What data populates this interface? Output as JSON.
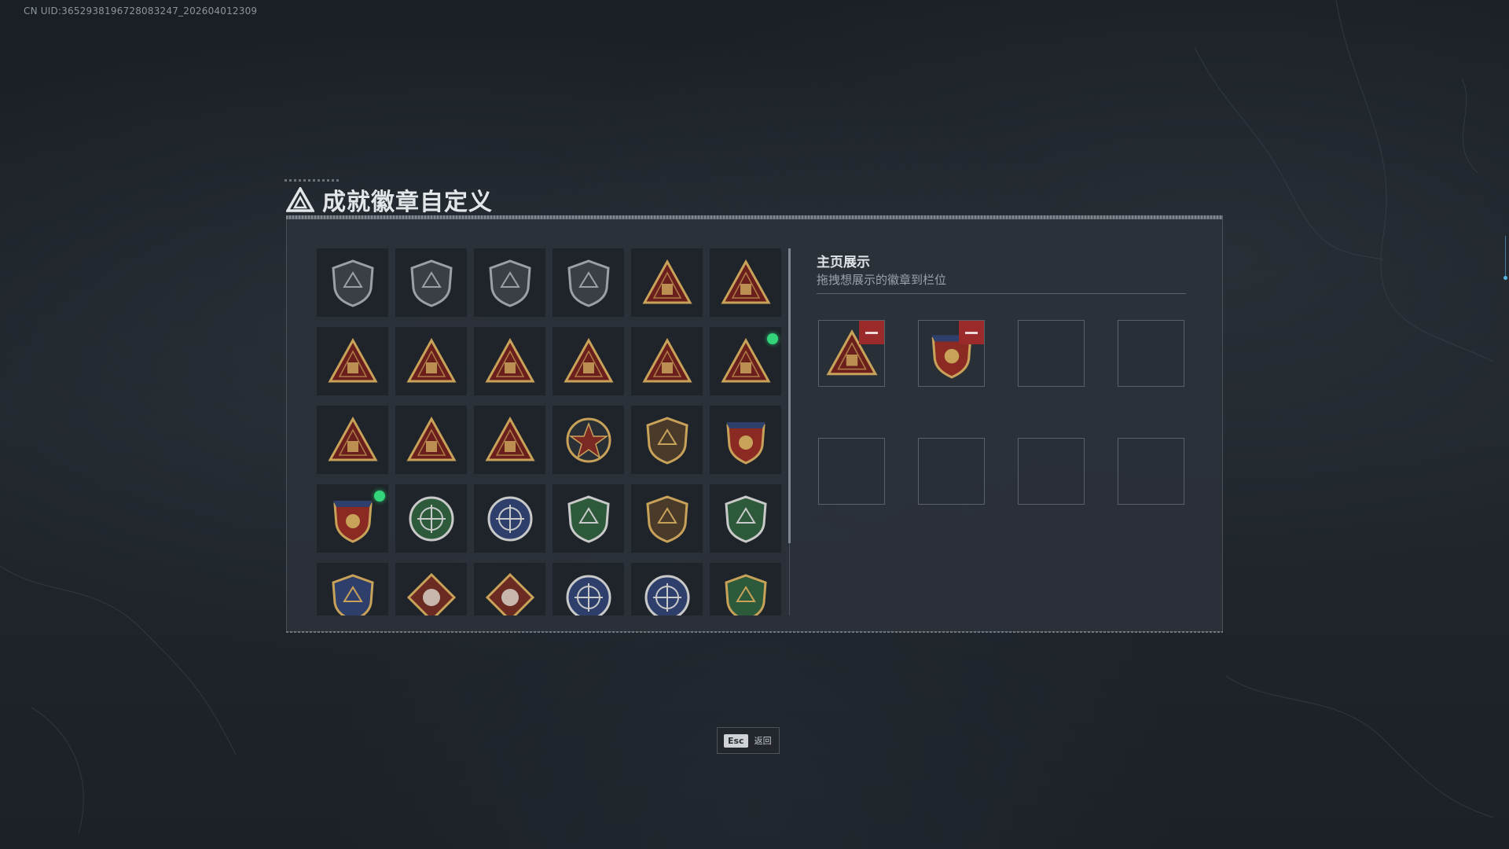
{
  "uid_text": "CN UID:3652938196728083247_202604012309",
  "page": {
    "title": "成就徽章自定义"
  },
  "badges": [
    {
      "shape": "shield",
      "color": "#3a3f45",
      "accent": "#9aa0a6",
      "new": false
    },
    {
      "shape": "shield",
      "color": "#3a3f45",
      "accent": "#9aa0a6",
      "new": false
    },
    {
      "shape": "shield",
      "color": "#3a3f45",
      "accent": "#9aa0a6",
      "new": false
    },
    {
      "shape": "shield",
      "color": "#3a3f45",
      "accent": "#9aa0a6",
      "new": false
    },
    {
      "shape": "triangle",
      "color": "#6b1f1c",
      "accent": "#c9a25a",
      "new": false
    },
    {
      "shape": "triangle",
      "color": "#6b1f1c",
      "accent": "#c9a25a",
      "new": false
    },
    {
      "shape": "triangle",
      "color": "#6b1f1c",
      "accent": "#c9a25a",
      "new": false
    },
    {
      "shape": "triangle",
      "color": "#6b1f1c",
      "accent": "#c9a25a",
      "new": false
    },
    {
      "shape": "triangle",
      "color": "#6b1f1c",
      "accent": "#c9a25a",
      "new": false
    },
    {
      "shape": "triangle",
      "color": "#6b1f1c",
      "accent": "#c9a25a",
      "new": false
    },
    {
      "shape": "triangle",
      "color": "#6b1f1c",
      "accent": "#c9a25a",
      "new": false
    },
    {
      "shape": "triangle",
      "color": "#6b1f1c",
      "accent": "#c9a25a",
      "new": true
    },
    {
      "shape": "triangle",
      "color": "#6b1f1c",
      "accent": "#c9a25a",
      "new": false
    },
    {
      "shape": "triangle",
      "color": "#6b1f1c",
      "accent": "#c9a25a",
      "new": false
    },
    {
      "shape": "triangle",
      "color": "#6b1f1c",
      "accent": "#c9a25a",
      "new": false
    },
    {
      "shape": "star",
      "color": "#7a2a22",
      "accent": "#c9a25a",
      "new": false
    },
    {
      "shape": "shield",
      "color": "#4a3a2a",
      "accent": "#c9a25a",
      "new": false
    },
    {
      "shape": "crest",
      "color": "#8a2a22",
      "accent": "#c9a25a",
      "new": false
    },
    {
      "shape": "crest",
      "color": "#8a2a22",
      "accent": "#c9a25a",
      "new": true
    },
    {
      "shape": "circle",
      "color": "#2d5a3a",
      "accent": "#c9c9c9",
      "new": false
    },
    {
      "shape": "circle",
      "color": "#2d3f6a",
      "accent": "#c9c9c9",
      "new": false
    },
    {
      "shape": "shield",
      "color": "#2d5a3a",
      "accent": "#c9c9c9",
      "new": false
    },
    {
      "shape": "shield",
      "color": "#4a3a2a",
      "accent": "#c9a25a",
      "new": false
    },
    {
      "shape": "shield",
      "color": "#2d5a3a",
      "accent": "#c9c9c9",
      "new": false
    },
    {
      "shape": "shield",
      "color": "#2d3f6a",
      "accent": "#c9a25a",
      "new": false
    },
    {
      "shape": "diamond",
      "color": "#6b2a22",
      "accent": "#c9a25a",
      "new": false
    },
    {
      "shape": "diamond",
      "color": "#6b2a22",
      "accent": "#c9a25a",
      "new": false
    },
    {
      "shape": "circle",
      "color": "#2d3f6a",
      "accent": "#c9c9c9",
      "new": false
    },
    {
      "shape": "circle",
      "color": "#2d3f6a",
      "accent": "#c9c9c9",
      "new": false
    },
    {
      "shape": "shield",
      "color": "#2d5a3a",
      "accent": "#c9a25a",
      "new": false
    }
  ],
  "showcase": {
    "title": "主页展示",
    "hint": "拖拽想展示的徽章到栏位",
    "slots": [
      {
        "filled": true,
        "shape": "triangle",
        "color": "#6b1f1c",
        "accent": "#c9a25a"
      },
      {
        "filled": true,
        "shape": "crest",
        "color": "#8a2a22",
        "accent": "#c9a25a"
      },
      {
        "filled": false
      },
      {
        "filled": false
      },
      {
        "filled": false
      },
      {
        "filled": false
      },
      {
        "filled": false
      },
      {
        "filled": false
      }
    ]
  },
  "footer": {
    "esc_key": "Esc",
    "esc_label": "返回"
  }
}
